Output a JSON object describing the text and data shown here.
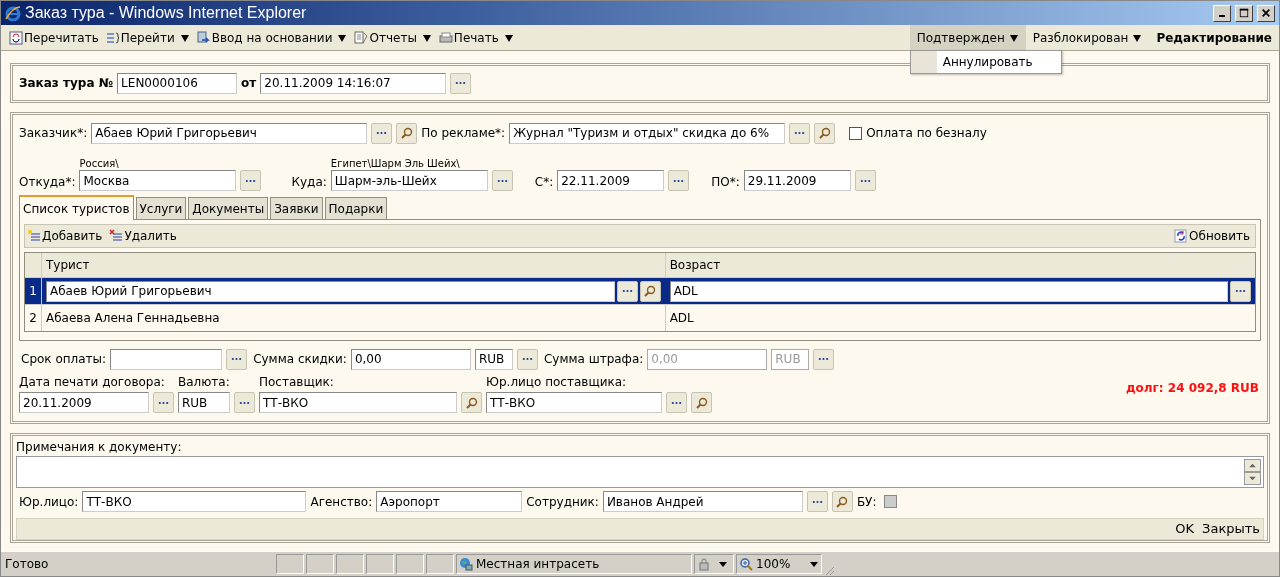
{
  "window": {
    "title": "Заказ тура - Windows Internet Explorer"
  },
  "toolbar": {
    "actions": [
      {
        "label": "Перечитать",
        "has_menu": false
      },
      {
        "label": "Перейти",
        "has_menu": true
      },
      {
        "label": "Ввод на основании",
        "has_menu": true
      },
      {
        "label": "Отчеты",
        "has_menu": true
      },
      {
        "label": "Печать",
        "has_menu": true
      }
    ],
    "states": [
      {
        "label": "Подтвержден",
        "has_menu": true,
        "open": true,
        "current": false
      },
      {
        "label": "Разблокирован",
        "has_menu": true,
        "open": false,
        "current": false
      },
      {
        "label": "Редактирование",
        "has_menu": false,
        "open": false,
        "current": true
      }
    ],
    "state_menu": [
      "Аннулировать"
    ]
  },
  "order": {
    "label": "Заказ тура №",
    "number": "LEN0000106",
    "date_label": "от",
    "date": "20.11.2009 14:16:07"
  },
  "customer": {
    "label": "Заказчик*:",
    "value": "Абаев Юрий Григорьевич"
  },
  "advert": {
    "label": "По рекламе*:",
    "value": "Журнал \"Туризм и отдых\" скидка до 6%"
  },
  "cashless": {
    "label": "Оплата по безналу",
    "checked": false
  },
  "from": {
    "label": "Откуда*:",
    "hint": "Россия\\",
    "value": "Москва"
  },
  "to": {
    "label": "Куда:",
    "hint": "Египет\\Шарм Эль Шейх\\",
    "value": "Шарм-эль-Шейх"
  },
  "date_from": {
    "label": "С*:",
    "value": "22.11.2009"
  },
  "date_to": {
    "label": "ПО*:",
    "value": "29.11.2009"
  },
  "tabs": [
    {
      "label": "Список туристов",
      "selected": true
    },
    {
      "label": "Услуги",
      "selected": false
    },
    {
      "label": "Документы",
      "selected": false
    },
    {
      "label": "Заявки",
      "selected": false
    },
    {
      "label": "Подарки",
      "selected": false
    }
  ],
  "tourists": {
    "actions": [
      "Добавить",
      "Удалить"
    ],
    "refresh": "Обновить",
    "columns": [
      "Турист",
      "Возраст"
    ],
    "rows": [
      {
        "num": "1",
        "tourist": "Абаев Юрий Григорьевич",
        "age": "ADL",
        "selected": true
      },
      {
        "num": "2",
        "tourist": "Абаева Алена Геннадьевна",
        "age": "ADL",
        "selected": false
      }
    ]
  },
  "payment_due": {
    "label": "Срок оплаты:"
  },
  "discount": {
    "label": "Сумма скидки:",
    "value": "0,00",
    "currency": "RUB",
    "disabled": false
  },
  "penalty": {
    "label": "Сумма штрафа:",
    "value": "0,00",
    "currency": "RUB",
    "disabled": true
  },
  "print_date": {
    "label": "Дата печати договора:",
    "value": "20.11.2009"
  },
  "currency": {
    "label": "Валюта:",
    "value": "RUB"
  },
  "supplier": {
    "label": "Поставщик:",
    "value": "ТТ-ВКО"
  },
  "supplier_entity": {
    "label": "Юр.лицо поставщика:",
    "value": "ТТ-ВКО"
  },
  "debt": "долг: 24 092,8 RUB",
  "notes": {
    "label": "Примечания к документу:"
  },
  "legal_entity": {
    "label": "Юр.лицо:",
    "value": "ТТ-ВКО"
  },
  "agency": {
    "label": "Агенство:",
    "value": "Аэропорт"
  },
  "employee": {
    "label": "Сотрудник:",
    "value": "Иванов Андрей"
  },
  "bu": {
    "label": "БУ:",
    "checked": false,
    "disabled": true
  },
  "buttons": [
    "OK",
    "Закрыть"
  ],
  "status_bar": {
    "text": "Готово",
    "zone": "Местная интрасеть",
    "zoom": "100%"
  }
}
